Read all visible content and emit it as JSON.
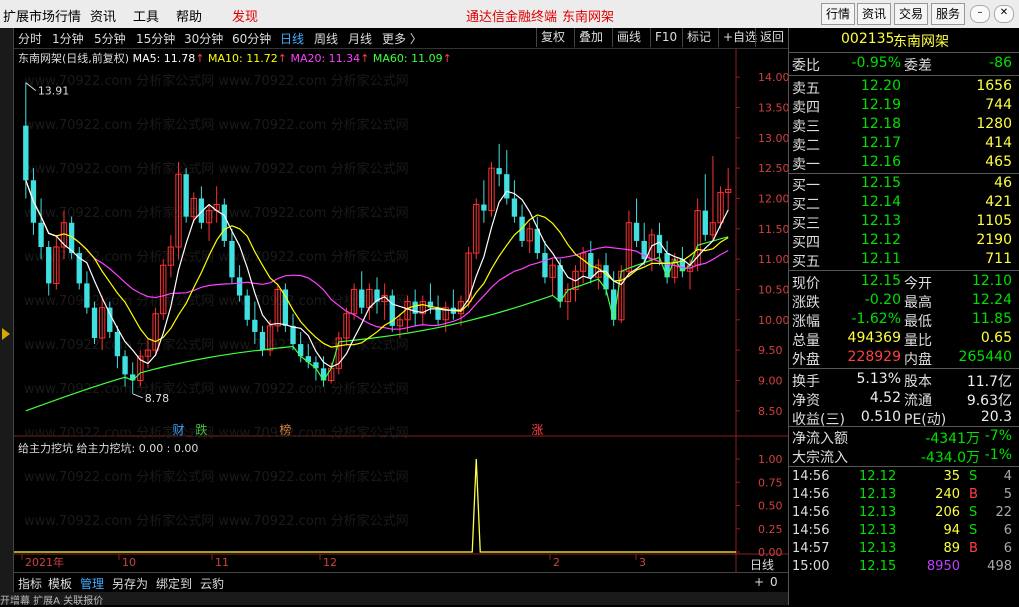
{
  "menu": {
    "items": [
      "扩展市场行情",
      "资讯",
      "工具",
      "帮助"
    ],
    "discover": "发现",
    "promo": [
      "通达信金融终端",
      "东南网架"
    ],
    "right_buttons": [
      "行情",
      "资讯",
      "交易",
      "服务"
    ]
  },
  "periods": [
    "分时",
    "1分钟",
    "5分钟",
    "15分钟",
    "30分钟",
    "60分钟",
    "日线",
    "周线",
    "月线",
    "更多 〉"
  ],
  "active_period": "日线",
  "toolbar": [
    "复权",
    "叠加",
    "画线",
    "F10",
    "标记",
    "+自选",
    "返回"
  ],
  "legend": {
    "title": "东南网架(日线,前复权)",
    "ma": [
      {
        "label": "MA5: 11.78",
        "color": "#ffffff"
      },
      {
        "label": "MA10: 11.72",
        "color": "#ffff00"
      },
      {
        "label": "MA20: 11.34",
        "color": "#ff40ff"
      },
      {
        "label": "MA60: 11.09",
        "color": "#40ff40"
      }
    ]
  },
  "price_axis": [
    "14.00",
    "13.50",
    "13.00",
    "12.50",
    "12.00",
    "11.50",
    "11.00",
    "10.50",
    "10.00",
    "9.50",
    "9.00",
    "8.50"
  ],
  "high_marker": "13.91",
  "low_marker": "8.78",
  "event_tags": [
    {
      "text": "财",
      "color": "#40a0ff"
    },
    {
      "text": "跌",
      "color": "#40c040"
    },
    {
      "text": "榜",
      "color": "#d08040"
    },
    {
      "text": "涨",
      "color": "#ff4040"
    }
  ],
  "sub": {
    "legend": "给主力挖坑  给主力挖坑: 0.00 : 0.00",
    "axis": [
      "1.00",
      "0.75",
      "0.50",
      "0.25",
      "0.00"
    ]
  },
  "time_axis": [
    "2021年",
    "10",
    "11",
    "12",
    "2",
    "3"
  ],
  "period_label": "日线",
  "bottom_tabs": [
    "指标",
    "模板",
    "管理",
    "另存为",
    "绑定到",
    "云豹"
  ],
  "bottom_nav": [
    "+",
    "0"
  ],
  "footer": "开增幕  扩展A  关联报价",
  "watermark": "www.70922.com  分析家公式网",
  "quote": {
    "code": "002135",
    "name": "东南网架",
    "weibi_label": "委比",
    "weibi": "-0.95%",
    "weicha_label": "委差",
    "weicha": "-86",
    "asks": [
      {
        "label": "卖五",
        "price": "12.20",
        "vol": "1656"
      },
      {
        "label": "卖四",
        "price": "12.19",
        "vol": "744"
      },
      {
        "label": "卖三",
        "price": "12.18",
        "vol": "1280"
      },
      {
        "label": "卖二",
        "price": "12.17",
        "vol": "414"
      },
      {
        "label": "卖一",
        "price": "12.16",
        "vol": "465"
      }
    ],
    "bids": [
      {
        "label": "买一",
        "price": "12.15",
        "vol": "46"
      },
      {
        "label": "买二",
        "price": "12.14",
        "vol": "421"
      },
      {
        "label": "买三",
        "price": "12.13",
        "vol": "1105"
      },
      {
        "label": "买四",
        "price": "12.12",
        "vol": "2190"
      },
      {
        "label": "买五",
        "price": "12.11",
        "vol": "711"
      }
    ],
    "stats": [
      {
        "l1": "现价",
        "v1": "12.15",
        "c1": "green",
        "l2": "今开",
        "v2": "12.10",
        "c2": "green"
      },
      {
        "l1": "涨跌",
        "v1": "-0.20",
        "c1": "green",
        "l2": "最高",
        "v2": "12.24",
        "c2": "green"
      },
      {
        "l1": "涨幅",
        "v1": "-1.62%",
        "c1": "green",
        "l2": "最低",
        "v2": "11.85",
        "c2": "green"
      },
      {
        "l1": "总量",
        "v1": "494369",
        "c1": "yellow",
        "l2": "量比",
        "v2": "0.65",
        "c2": "yellow"
      },
      {
        "l1": "外盘",
        "v1": "228929",
        "c1": "red",
        "l2": "内盘",
        "v2": "265440",
        "c2": "green"
      }
    ],
    "stats2": [
      {
        "l1": "换手",
        "v1": "5.13%",
        "l2": "股本",
        "v2": "11.7亿"
      },
      {
        "l1": "净资",
        "v1": "4.52",
        "l2": "流通",
        "v2": "9.63亿"
      },
      {
        "l1": "收益(三)",
        "v1": "0.510",
        "l2": "PE(动)",
        "v2": "20.3"
      }
    ],
    "flows": [
      {
        "label": "净流入额",
        "val": "-4341万",
        "pct": "-7%"
      },
      {
        "label": "大宗流入",
        "val": "-434.0万",
        "pct": "-1%"
      }
    ],
    "ticks": [
      {
        "time": "14:56",
        "price": "12.12",
        "vol": "35",
        "side": "S",
        "n": "4"
      },
      {
        "time": "14:56",
        "price": "12.13",
        "vol": "240",
        "side": "B",
        "n": "5"
      },
      {
        "time": "14:56",
        "price": "12.13",
        "vol": "206",
        "side": "S",
        "n": "22"
      },
      {
        "time": "14:56",
        "price": "12.13",
        "vol": "94",
        "side": "S",
        "n": "6"
      },
      {
        "time": "14:57",
        "price": "12.13",
        "vol": "89",
        "side": "B",
        "n": "6"
      },
      {
        "time": "15:00",
        "price": "12.15",
        "vol": "8950",
        "side": "",
        "n": "498"
      }
    ]
  },
  "chart_data": {
    "type": "candlestick",
    "ylim": [
      8.2,
      14.2
    ],
    "candles": [
      [
        13.2,
        13.91,
        12.0,
        12.3
      ],
      [
        12.3,
        12.5,
        11.4,
        11.6
      ],
      [
        11.6,
        12.0,
        11.0,
        11.2
      ],
      [
        11.2,
        11.3,
        10.4,
        10.6
      ],
      [
        10.6,
        11.4,
        10.5,
        11.2
      ],
      [
        11.2,
        11.8,
        11.0,
        11.6
      ],
      [
        11.6,
        11.7,
        11.0,
        11.1
      ],
      [
        11.1,
        11.2,
        10.5,
        10.6
      ],
      [
        10.6,
        10.8,
        10.1,
        10.2
      ],
      [
        10.2,
        10.3,
        9.6,
        9.7
      ],
      [
        9.7,
        10.4,
        9.5,
        10.2
      ],
      [
        10.2,
        10.3,
        9.7,
        9.8
      ],
      [
        9.8,
        9.9,
        9.2,
        9.4
      ],
      [
        9.4,
        9.5,
        8.9,
        9.1
      ],
      [
        9.1,
        9.3,
        8.78,
        9.0
      ],
      [
        9.0,
        9.5,
        8.9,
        9.4
      ],
      [
        9.4,
        9.7,
        9.2,
        9.5
      ],
      [
        9.5,
        10.2,
        9.4,
        10.1
      ],
      [
        10.1,
        11.0,
        10.0,
        10.9
      ],
      [
        10.9,
        11.4,
        10.7,
        11.2
      ],
      [
        11.2,
        12.6,
        11.0,
        12.4
      ],
      [
        12.4,
        12.5,
        11.6,
        11.7
      ],
      [
        11.7,
        12.1,
        11.6,
        12.0
      ],
      [
        12.0,
        12.2,
        11.5,
        11.6
      ],
      [
        11.6,
        11.9,
        11.3,
        11.8
      ],
      [
        11.8,
        12.2,
        11.6,
        11.9
      ],
      [
        11.9,
        12.0,
        11.2,
        11.3
      ],
      [
        11.3,
        11.5,
        10.6,
        10.7
      ],
      [
        10.7,
        10.9,
        10.3,
        10.4
      ],
      [
        10.4,
        10.5,
        9.9,
        10.0
      ],
      [
        10.0,
        10.3,
        9.6,
        9.8
      ],
      [
        9.8,
        9.9,
        9.4,
        9.5
      ],
      [
        9.5,
        10.0,
        9.4,
        9.9
      ],
      [
        9.9,
        10.6,
        9.8,
        10.5
      ],
      [
        10.5,
        10.6,
        9.8,
        9.9
      ],
      [
        9.9,
        10.1,
        9.5,
        9.6
      ],
      [
        9.6,
        9.8,
        9.3,
        9.4
      ],
      [
        9.4,
        9.6,
        9.2,
        9.3
      ],
      [
        9.3,
        9.4,
        9.0,
        9.2
      ],
      [
        9.2,
        9.4,
        8.9,
        9.0
      ],
      [
        9.0,
        9.3,
        8.95,
        9.2
      ],
      [
        9.2,
        9.8,
        9.1,
        9.7
      ],
      [
        9.7,
        10.2,
        9.6,
        10.1
      ],
      [
        10.1,
        10.6,
        10.0,
        10.5
      ],
      [
        10.5,
        10.8,
        10.1,
        10.2
      ],
      [
        10.2,
        10.6,
        10.0,
        10.5
      ],
      [
        10.5,
        10.7,
        10.1,
        10.3
      ],
      [
        10.3,
        10.6,
        10.0,
        10.4
      ],
      [
        10.4,
        10.5,
        9.8,
        9.9
      ],
      [
        9.9,
        10.1,
        9.7,
        10.0
      ],
      [
        10.0,
        10.4,
        9.8,
        10.3
      ],
      [
        10.3,
        10.5,
        9.9,
        10.1
      ],
      [
        10.1,
        10.4,
        9.9,
        10.3
      ],
      [
        10.3,
        10.6,
        10.1,
        10.2
      ],
      [
        10.2,
        10.4,
        9.9,
        10.0
      ],
      [
        10.0,
        10.3,
        9.8,
        10.2
      ],
      [
        10.2,
        10.5,
        10.0,
        10.1
      ],
      [
        10.1,
        10.4,
        9.9,
        10.3
      ],
      [
        10.3,
        11.2,
        10.2,
        11.1
      ],
      [
        11.1,
        12.0,
        11.0,
        11.9
      ],
      [
        11.9,
        12.3,
        11.6,
        11.8
      ],
      [
        11.8,
        12.6,
        11.7,
        12.5
      ],
      [
        12.5,
        12.9,
        12.2,
        12.4
      ],
      [
        12.4,
        12.8,
        11.9,
        12.0
      ],
      [
        12.0,
        12.3,
        11.6,
        11.7
      ],
      [
        11.7,
        11.9,
        11.2,
        11.3
      ],
      [
        11.3,
        11.6,
        11.1,
        11.5
      ],
      [
        11.5,
        11.7,
        11.0,
        11.1
      ],
      [
        11.1,
        11.3,
        10.6,
        10.7
      ],
      [
        10.7,
        11.0,
        10.4,
        10.9
      ],
      [
        10.9,
        11.0,
        10.2,
        10.3
      ],
      [
        10.3,
        10.6,
        10.0,
        10.5
      ],
      [
        10.5,
        10.9,
        10.3,
        10.8
      ],
      [
        10.8,
        11.2,
        10.6,
        11.1
      ],
      [
        11.1,
        11.3,
        10.6,
        10.7
      ],
      [
        10.7,
        11.0,
        10.5,
        10.9
      ],
      [
        10.9,
        11.1,
        10.4,
        10.5
      ],
      [
        10.5,
        10.8,
        9.9,
        10.0
      ],
      [
        10.0,
        10.9,
        9.95,
        10.8
      ],
      [
        10.8,
        11.8,
        10.7,
        11.6
      ],
      [
        11.6,
        12.0,
        11.2,
        11.3
      ],
      [
        11.3,
        11.6,
        10.9,
        11.0
      ],
      [
        11.0,
        11.5,
        10.8,
        11.4
      ],
      [
        11.4,
        11.6,
        10.9,
        11.1
      ],
      [
        11.1,
        11.3,
        10.6,
        10.7
      ],
      [
        10.7,
        11.1,
        10.6,
        11.0
      ],
      [
        11.0,
        11.2,
        10.7,
        10.8
      ],
      [
        10.8,
        11.0,
        10.5,
        10.9
      ],
      [
        10.9,
        12.0,
        10.8,
        11.8
      ],
      [
        11.8,
        12.4,
        11.3,
        11.4
      ],
      [
        11.4,
        12.7,
        11.3,
        11.6
      ],
      [
        11.6,
        12.2,
        11.5,
        12.1
      ],
      [
        12.1,
        12.5,
        11.8,
        12.15
      ]
    ],
    "sub_signal_index": 59
  }
}
